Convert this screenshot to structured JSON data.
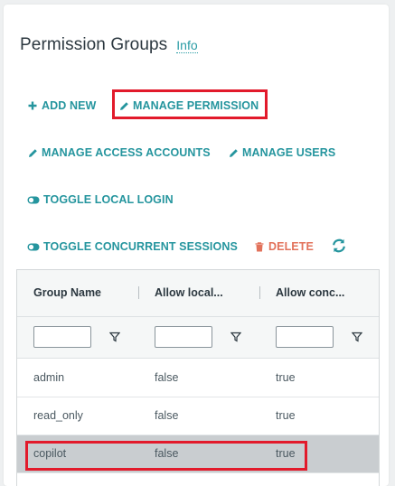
{
  "header": {
    "title": "Permission Groups",
    "info_link": "Info"
  },
  "actions": {
    "add_new": "ADD NEW",
    "manage_permission": "MANAGE PERMISSION",
    "manage_access_accounts": "MANAGE ACCESS ACCOUNTS",
    "manage_users": "MANAGE USERS",
    "toggle_local_login": "TOGGLE LOCAL LOGIN",
    "toggle_concurrent_sessions": "TOGGLE CONCURRENT SESSIONS",
    "delete": "DELETE"
  },
  "icons": {
    "add": "plus-icon",
    "edit": "pencil-icon",
    "toggle": "toggle-icon",
    "delete": "trash-icon",
    "refresh": "refresh-icon",
    "filter": "funnel-icon"
  },
  "grid": {
    "columns": [
      "Group Name",
      "Allow local...",
      "Allow conc..."
    ],
    "filters": [
      "",
      "",
      ""
    ],
    "rows": [
      {
        "group": "admin",
        "local": "false",
        "concurrent": "true"
      },
      {
        "group": "read_only",
        "local": "false",
        "concurrent": "true"
      },
      {
        "group": "copilot",
        "local": "false",
        "concurrent": "true"
      }
    ]
  },
  "colors": {
    "accent": "#25959e",
    "danger": "#e2725b",
    "highlight": "#e21a2b",
    "selected_row": "#c9cdd0"
  }
}
